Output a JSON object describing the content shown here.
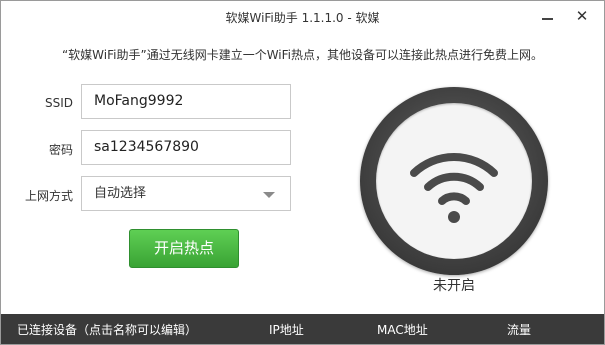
{
  "window": {
    "title": "软媒WiFi助手 1.1.1.0 - 软媒",
    "minimize_symbol": "—",
    "close_symbol": "✕"
  },
  "description": "“软媒WiFi助手”通过无线网卡建立一个WiFi热点，其他设备可以连接此热点进行免费上网。",
  "form": {
    "ssid_label": "SSID",
    "ssid_value": "MoFang9992",
    "password_label": "密码",
    "password_value": "sa1234567890",
    "mode_label": "上网方式",
    "mode_value": "自动选择"
  },
  "start_button_label": "开启热点",
  "status": {
    "text": "未开启",
    "icon": "wifi-icon"
  },
  "device_table": {
    "columns": [
      "已连接设备（点击名称可以编辑）",
      "IP地址",
      "MAC地址",
      "流量"
    ]
  },
  "colors": {
    "button_green": "#39a334",
    "bottom_bar": "#3a3a3a",
    "ring_dark": "#444444"
  }
}
